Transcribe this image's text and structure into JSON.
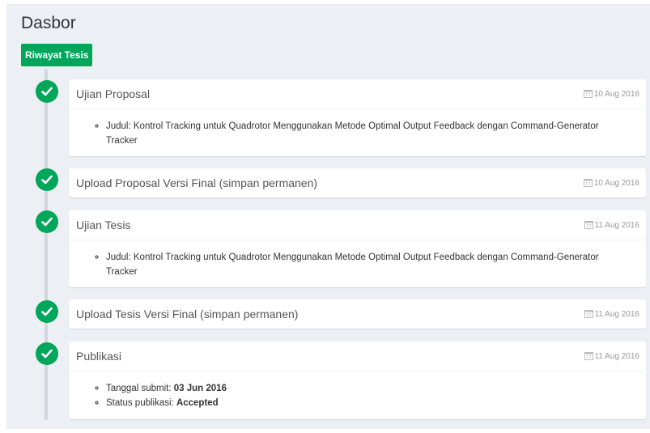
{
  "page_title": "Dasbor",
  "history_label": "Riwayat Tesis",
  "colors": {
    "success": "#00a65a",
    "background": "#ecf0f5",
    "timeline": "#d2d6de"
  },
  "icons": {
    "item": "check-icon",
    "date": "calendar-icon"
  },
  "timeline": [
    {
      "title": "Ujian Proposal",
      "date": "10 Aug 2016",
      "detail_label": "Judul: ",
      "detail_value": "Kontrol Tracking untuk Quadrotor Menggunakan Metode Optimal Output Feedback dengan Command-Generator Tracker"
    },
    {
      "title": "Upload Proposal Versi Final (simpan permanen)",
      "date": "10 Aug 2016"
    },
    {
      "title": "Ujian Tesis",
      "date": "11 Aug 2016",
      "detail_label": "Judul: ",
      "detail_value": "Kontrol Tracking untuk Quadrotor Menggunakan Metode Optimal Output Feedback dengan Command-Generator Tracker"
    },
    {
      "title": "Upload Tesis Versi Final (simpan permanen)",
      "date": "11 Aug 2016"
    },
    {
      "title": "Publikasi",
      "date": "11 Aug 2016",
      "submit_label": "Tanggal submit: ",
      "submit_value": "03 Jun 2016",
      "status_label": "Status publikasi: ",
      "status_value": "Accepted"
    }
  ]
}
